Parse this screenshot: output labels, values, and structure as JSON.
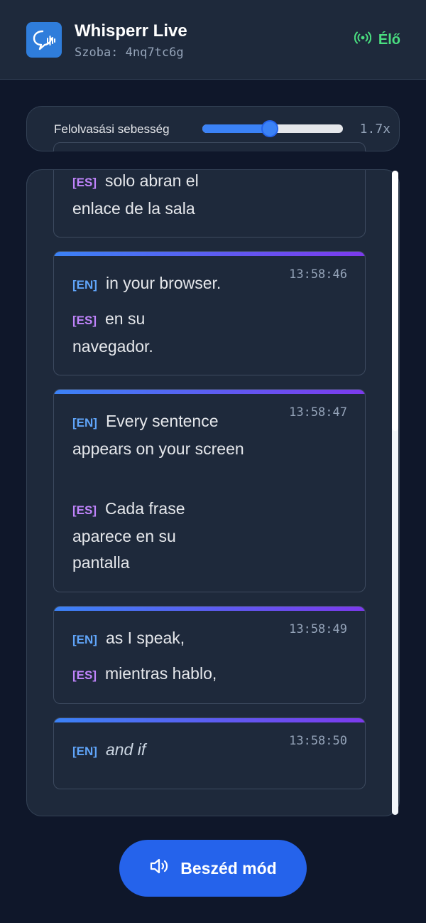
{
  "header": {
    "title": "Whisperr Live",
    "room_label": "Szoba:",
    "room_id": "4nq7tc6g",
    "live_label": "Élő"
  },
  "speed": {
    "label": "Felolvasási sebesség",
    "value_text": "1.7x",
    "level_fraction": 0.48
  },
  "messages": [
    {
      "en": "",
      "es": "solo abran el enlace de la sala",
      "time": ""
    },
    {
      "en": "in your browser.",
      "es": "en su navegador.",
      "time": "13:58:46"
    },
    {
      "en": "Every sentence appears on your screen",
      "es": "Cada frase aparece en su pantalla",
      "time": "13:58:47"
    },
    {
      "en": "as I speak,",
      "es": "mientras hablo,",
      "time": "13:58:49"
    },
    {
      "en": "and if",
      "es": "",
      "time": "13:58:50"
    }
  ],
  "tags": {
    "en": "[EN]",
    "es": "[ES]"
  },
  "speak_button": {
    "label": "Beszéd mód"
  },
  "colors": {
    "accent": "#2563eb",
    "live": "#4ade80",
    "en_tag": "#60a5fa",
    "es_tag": "#c084fc"
  }
}
